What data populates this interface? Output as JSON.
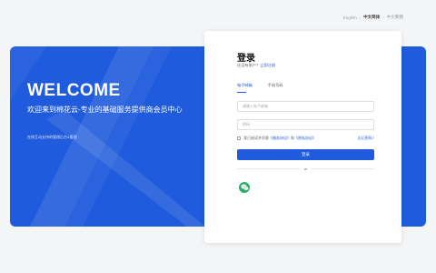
{
  "language": {
    "options": [
      "English",
      "中文简体",
      "中文繁體"
    ],
    "selected_index": 1
  },
  "banner": {
    "welcome": "WELCOME",
    "slogan": "欢迎来到棉花云-专业的基础服务提供商会员中心",
    "description": "在线互动支持的管理后台&管理"
  },
  "login": {
    "title": "登录",
    "no_account_text": "还没有账户?",
    "register_link": "立即注册",
    "tabs": [
      "电子邮箱",
      "手机号码"
    ],
    "active_tab_index": 0,
    "email_placeholder": "请输入电子邮箱",
    "password_placeholder": "密码",
    "agree_prefix": "我已阅读并同意",
    "service_terms": "《服务协议》",
    "and_text": "和",
    "privacy_policy": "《隐私协议》",
    "forgot_password": "忘记密码?",
    "submit_label": "登录",
    "or_text": "or"
  },
  "colors": {
    "brand_blue": "#1f5bdc",
    "wechat_green": "#2aae67",
    "page_background": "#f4f5f7"
  },
  "icons": {
    "wechat": "wechat-icon"
  }
}
